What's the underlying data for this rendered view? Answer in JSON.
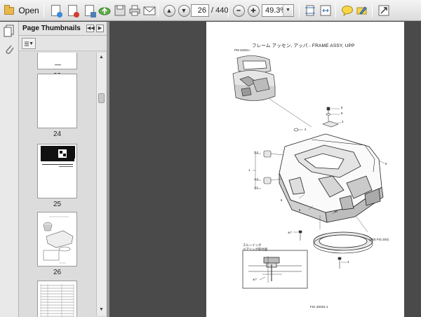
{
  "toolbar": {
    "open_label": "Open",
    "current_page": "26",
    "total_pages": "/ 440",
    "zoom": "49.3%"
  },
  "panel": {
    "title": "Page Thumbnails",
    "thumbnails": [
      {
        "label": "23"
      },
      {
        "label": "24"
      },
      {
        "label": "25"
      },
      {
        "label": "26"
      }
    ]
  },
  "document": {
    "title": "フレーム アッセン, アッパ - FRAME ASSY, UPP",
    "ref": "PM 32001~",
    "footer": "FIG 3S001-1",
    "labels": {
      "l5": "5",
      "l6": "6",
      "l3": "3",
      "l2": "2",
      "l12a": "1-2",
      "l1": "1",
      "l12b": "1-2",
      "l11": "1-1",
      "l9a": "9",
      "l8": "8",
      "l9b": "9",
      "l10": "10",
      "l7": "※7",
      "ref_fig": "(SEE FIG 2S0)",
      "l4": "4",
      "l7b": "※7"
    },
    "inset_line1": "スルーイング",
    "inset_line2": "ベアリング取付図"
  }
}
